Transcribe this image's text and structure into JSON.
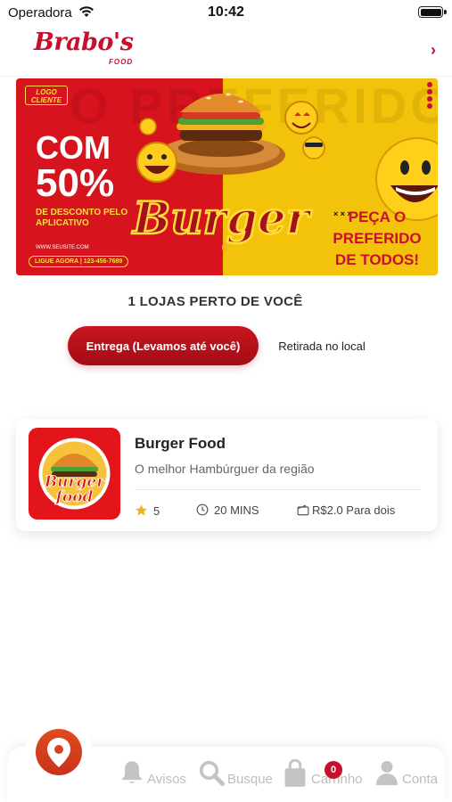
{
  "status_bar": {
    "carrier": "Operadora",
    "time": "10:42"
  },
  "header": {
    "brand": "Brabo's",
    "brand_sub": "FOOD",
    "chevron": "›"
  },
  "banner": {
    "logo_cliente": "LOGO CLIENTE",
    "com": "COM",
    "percent": "50%",
    "desc": "DE DESCONTO PELO APLICATIVO",
    "site": "WWW.SEUSITE.COM",
    "call": "LIGUE AGORA | 123-456-7689",
    "burger_word": "Burger",
    "background_word": "O PREFERIDO",
    "right_promo_line1": "PEÇA O",
    "right_promo_line2": "PREFERIDO",
    "right_promo_line3": "DE TODOS!",
    "dots": "× × ×"
  },
  "stores_near_title": "1 LOJAS PERTO DE VOCÊ",
  "tabs": {
    "delivery": "Entrega (Levamos até você)",
    "pickup": "Retirada no local"
  },
  "store": {
    "name": "Burger Food",
    "description": "O melhor Hambúrguer da região",
    "rating": "5",
    "time": "20 MINS",
    "price": "R$2.0 Para dois",
    "thumb_line1": "Burger",
    "thumb_line2": "food"
  },
  "bottom_nav": {
    "avisos": "Avisos",
    "busque": "Busque",
    "carrinho": "Carrinho",
    "cart_count": "0",
    "conta": "Conta"
  },
  "colors": {
    "brand_red": "#c8102e",
    "banner_yellow": "#f3c20a",
    "fab_orange": "#d9401c",
    "nav_inactive": "#bdbdbd",
    "star": "#f2b01e"
  },
  "icons": [
    "wifi-icon",
    "battery-icon",
    "chevron-right-icon",
    "star-icon",
    "clock-icon",
    "wallet-icon",
    "location-pin-icon",
    "bell-icon",
    "search-icon",
    "shopping-bag-icon",
    "user-icon"
  ]
}
